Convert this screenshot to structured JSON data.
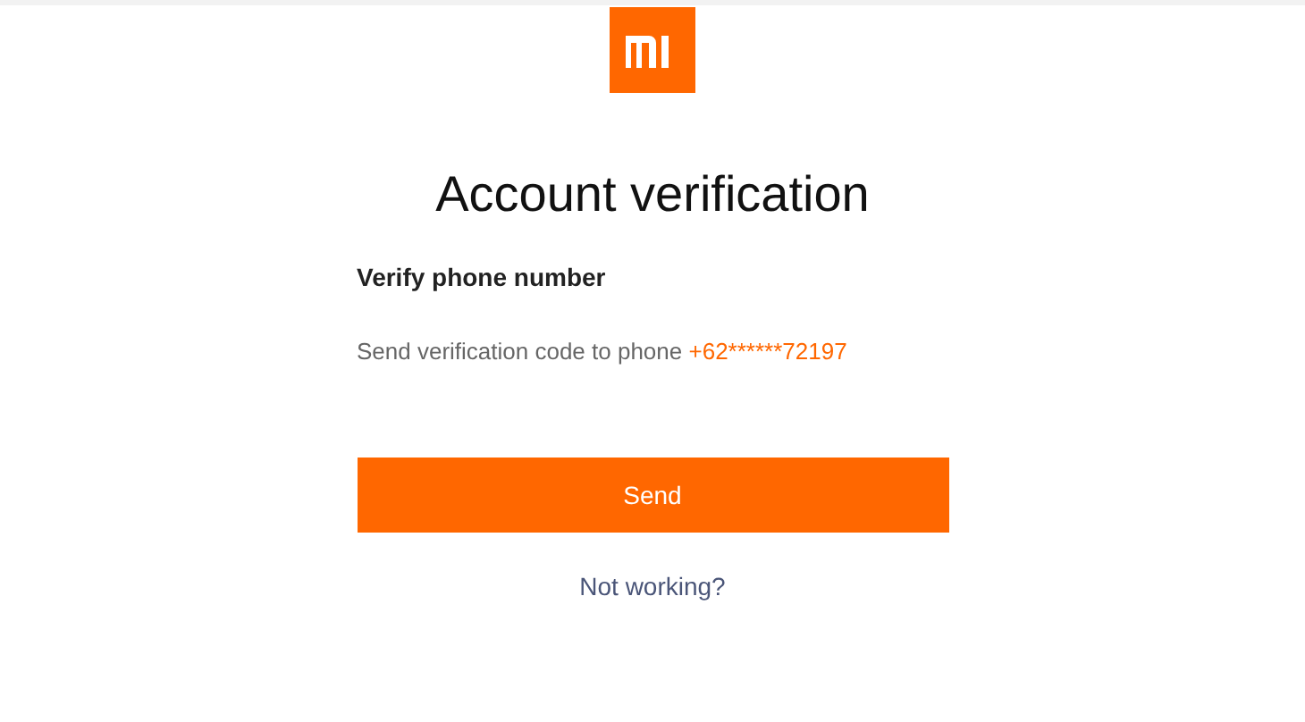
{
  "title": "Account verification",
  "section": {
    "heading": "Verify phone number",
    "message": "Send verification code to phone",
    "phone": "+62******72197"
  },
  "send_button": {
    "label": "Send"
  },
  "help_link": {
    "label": "Not working?"
  }
}
